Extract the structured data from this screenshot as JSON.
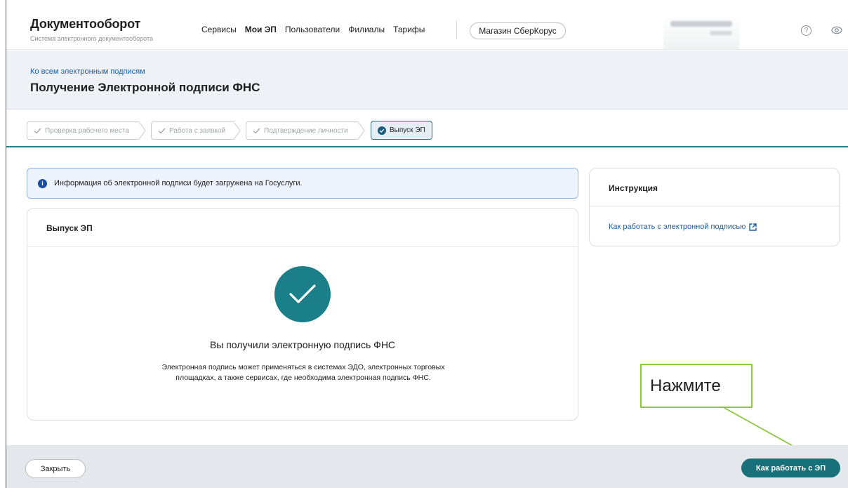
{
  "header": {
    "logo_title": "Документооборот",
    "logo_subtitle": "Система электронного документооборота",
    "nav": [
      {
        "label": "Сервисы",
        "active": false
      },
      {
        "label": "Мои ЭП",
        "active": true
      },
      {
        "label": "Пользователи",
        "active": false
      },
      {
        "label": "Филиалы",
        "active": false
      },
      {
        "label": "Тарифы",
        "active": false
      }
    ],
    "store_button": "Магазин СберКорус",
    "help_icon": "question-circle-icon",
    "view_icon": "eye-icon"
  },
  "title_band": {
    "back_link": "Ко всем электронным подписям",
    "page_title": "Получение Электронной подписи ФНС"
  },
  "steps": [
    {
      "label": "Проверка рабочего места",
      "state": "done"
    },
    {
      "label": "Работа с заявкой",
      "state": "done"
    },
    {
      "label": "Подтверждение личности",
      "state": "done"
    },
    {
      "label": "Выпуск ЭП",
      "state": "active"
    }
  ],
  "alert": {
    "icon": "info-icon",
    "text": "Информация об электронной подписи будет загружена на Госуслуги."
  },
  "card": {
    "title": "Выпуск ЭП",
    "success_icon": "check-circle-icon",
    "success_title": "Вы получили электронную подпись ФНС",
    "success_desc": "Электронная подпись может применяться в системах ЭДО, электронных торговых площадках, а также сервисах, где необходима электронная подпись ФНС."
  },
  "instruction": {
    "title": "Инструкция",
    "link": "Как работать с электронной подписью"
  },
  "callout": {
    "text": "Нажмите"
  },
  "footer": {
    "close_button": "Закрыть",
    "primary_button": "Как работать с ЭП"
  },
  "colors": {
    "accent": "#17707a",
    "link": "#1b5fa8",
    "callout_border": "#8dc63f",
    "title_band_bg": "#eef1f6",
    "footer_bg": "#e4e7eb"
  }
}
